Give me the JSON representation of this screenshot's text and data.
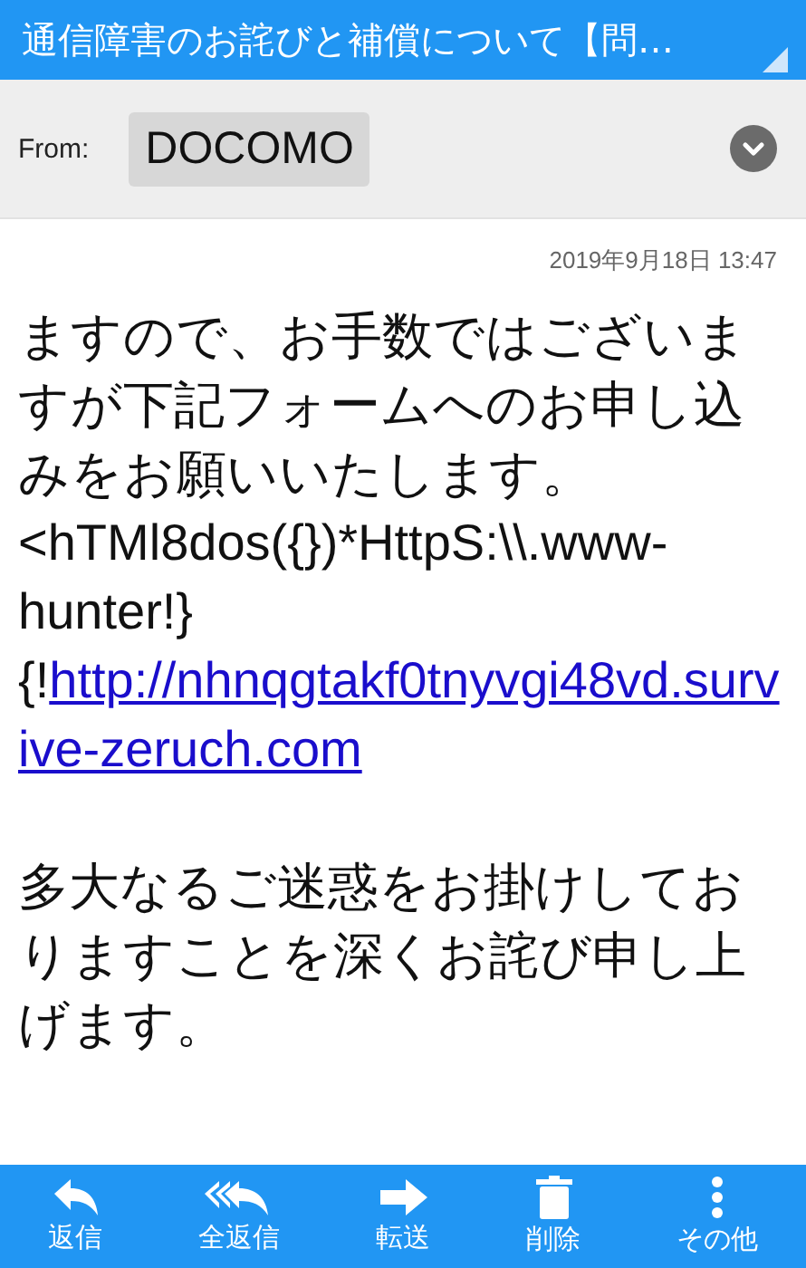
{
  "header": {
    "title": "通信障害のお詫びと補償について【問…"
  },
  "from": {
    "label": "From:",
    "sender": "DOCOMO"
  },
  "date": "2019年9月18日 13:47",
  "body": {
    "paragraph_1": "ますので、お手数ではございますが下記フォームへのお申し込みをお願いいたします。",
    "code_line": "<hTMl8dos({})*HttpS:\\\\.www-hunter!}",
    "link_prefix": "{!",
    "link": "http://nhnqgtakf0tnyvgi48vd.survive-zeruch.com",
    "paragraph_2": "多大なるご迷惑をお掛けしておりますことを深くお詫び申し上げます。"
  },
  "toolbar": [
    {
      "kind": "reply",
      "label": "返信"
    },
    {
      "kind": "reply_all",
      "label": "全返信"
    },
    {
      "kind": "forward",
      "label": "転送"
    },
    {
      "kind": "delete",
      "label": "削除"
    },
    {
      "kind": "more",
      "label": "その他"
    }
  ]
}
